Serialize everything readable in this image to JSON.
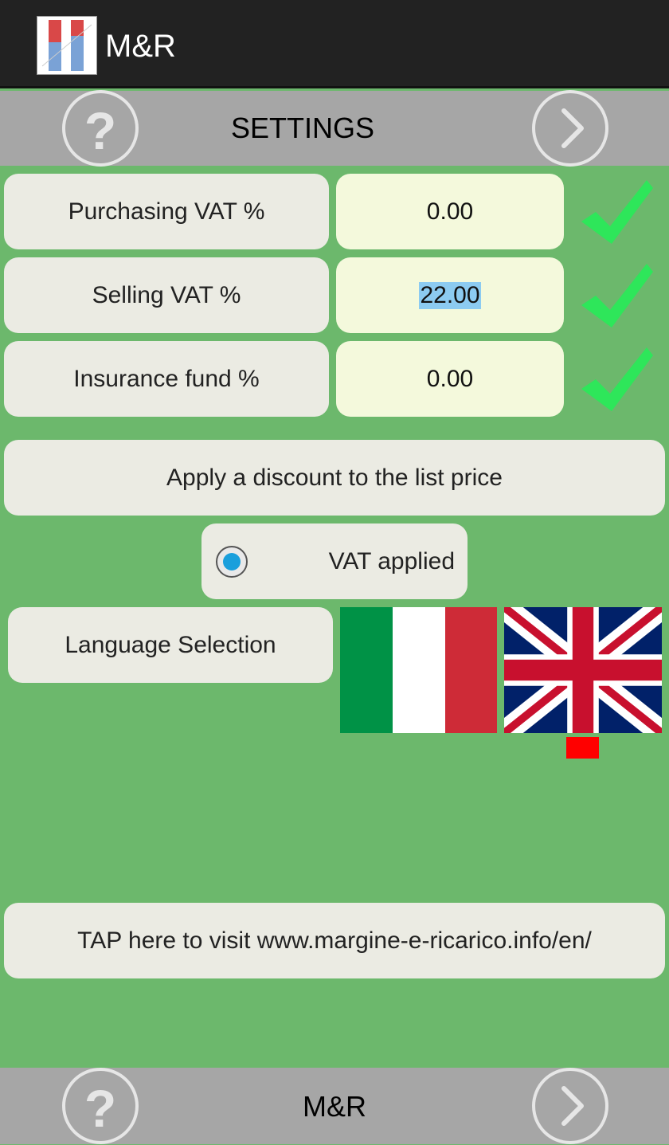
{
  "app": {
    "title": "M&R"
  },
  "header": {
    "title": "SETTINGS"
  },
  "settings": {
    "purchasing_vat": {
      "label": "Purchasing VAT %",
      "value": "0.00"
    },
    "selling_vat": {
      "label": "Selling VAT %",
      "value": "22.00"
    },
    "insurance_fund": {
      "label": "Insurance fund %",
      "value": "0.00"
    }
  },
  "discount": {
    "label": "Apply a discount to the list price"
  },
  "vat_applied": {
    "label": "VAT applied",
    "checked": true
  },
  "language": {
    "label": "Language Selection",
    "options": [
      "italian-flag",
      "uk-flag"
    ],
    "selected": "uk-flag"
  },
  "website": {
    "label": "TAP here to visit www.margine-e-ricarico.info/en/"
  },
  "footer": {
    "title": "M&R"
  },
  "colors": {
    "background": "#6cb86c",
    "bar": "#a6a6a6",
    "check": "#2ee65a",
    "radio": "#1a9fdc",
    "selection_marker": "#ff0000"
  }
}
